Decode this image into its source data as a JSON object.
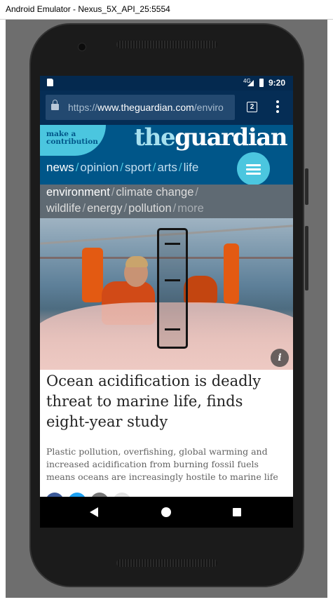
{
  "window": {
    "title": "Android Emulator - Nexus_5X_API_25:5554"
  },
  "status_bar": {
    "network": "4G",
    "time": "9:20"
  },
  "browser": {
    "url_prefix": "https://",
    "url_domain": "www.theguardian.com",
    "url_path": "/enviro",
    "tab_count": "2"
  },
  "guardian": {
    "contribution": [
      "make a",
      "contribution"
    ],
    "logo_the": "the",
    "logo_guardian": "guardian",
    "pillars": [
      "news",
      "opinion",
      "sport",
      "arts",
      "life"
    ],
    "subnav_row1": [
      "environment",
      "climate change"
    ],
    "subnav_row2": [
      "wildlife",
      "energy",
      "pollution",
      "more"
    ]
  },
  "article": {
    "info_label": "i",
    "headline": "Ocean acidification is deadly threat to marine life, finds eight-year study",
    "standfirst": "Plastic pollution, overfishing, global warming and increased acidification from burning fossil fuels means oceans are increasingly hostile to marine life"
  },
  "icons": {
    "sd_card": "sd-card-icon",
    "signal": "signal-icon",
    "battery": "battery-icon",
    "lock": "lock-icon",
    "tabs": "tabs-icon",
    "menu": "menu-dots-icon",
    "hamburger": "hamburger-menu-icon",
    "info": "info-icon",
    "back": "back-icon",
    "home": "home-icon",
    "recents": "recents-icon"
  },
  "colors": {
    "guardian_blue": "#005689",
    "guardian_accent": "#4bc6df",
    "status_bar": "#04294f",
    "url_bar": "#052d55",
    "subnav": "#5f6a73"
  }
}
